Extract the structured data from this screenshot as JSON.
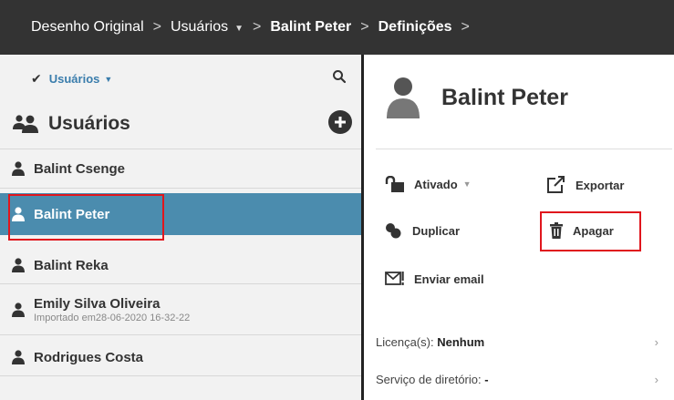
{
  "breadcrumb": {
    "items": [
      "Desenho Original",
      "Usuários",
      "Balint Peter",
      "Definições"
    ],
    "separator": ">"
  },
  "left_panel": {
    "filter_label": "Usuários",
    "title": "Usuários",
    "users": [
      {
        "name": "Balint Csenge",
        "subtitle": ""
      },
      {
        "name": "Balint Peter",
        "subtitle": "",
        "selected": true
      },
      {
        "name": "Balint Reka",
        "subtitle": ""
      },
      {
        "name": "Emily Silva Oliveira",
        "subtitle": "Importado em28-06-2020 16-32-22"
      },
      {
        "name": "Rodrigues Costa",
        "subtitle": ""
      }
    ]
  },
  "detail": {
    "name": "Balint Peter",
    "actions": {
      "ativado": "Ativado",
      "exportar": "Exportar",
      "duplicar": "Duplicar",
      "apagar": "Apagar",
      "enviar_email": "Enviar email"
    },
    "info": [
      {
        "label": "Licença(s): ",
        "value": "Nenhum"
      },
      {
        "label": "Serviço de diretório: ",
        "value": "-"
      }
    ]
  },
  "colors": {
    "topbar": "#333333",
    "selected_row": "#4b8cae",
    "link": "#3a7dac",
    "highlight": "#e0161d"
  }
}
